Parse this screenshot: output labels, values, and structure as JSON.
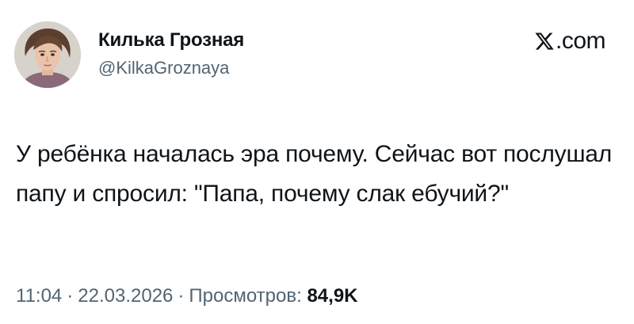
{
  "author": {
    "display_name": "Килька Грозная",
    "handle": "@KilkaGroznaya",
    "avatar_icon": "avatar-portrait"
  },
  "brand": {
    "icon": "x-logo-icon",
    "domain": ".com"
  },
  "tweet": {
    "text": "У ребёнка началась эра почему. Сейчас вот послушал папу и спросил: \"Папа, почему слак ебучий?\"",
    "time": "11:04",
    "date": "22.03.2026",
    "separator": "·",
    "views_label": "Просмотров:",
    "views_count": "84,9K"
  },
  "colors": {
    "text": "#0f1419",
    "secondary": "#536471",
    "background": "#ffffff"
  }
}
